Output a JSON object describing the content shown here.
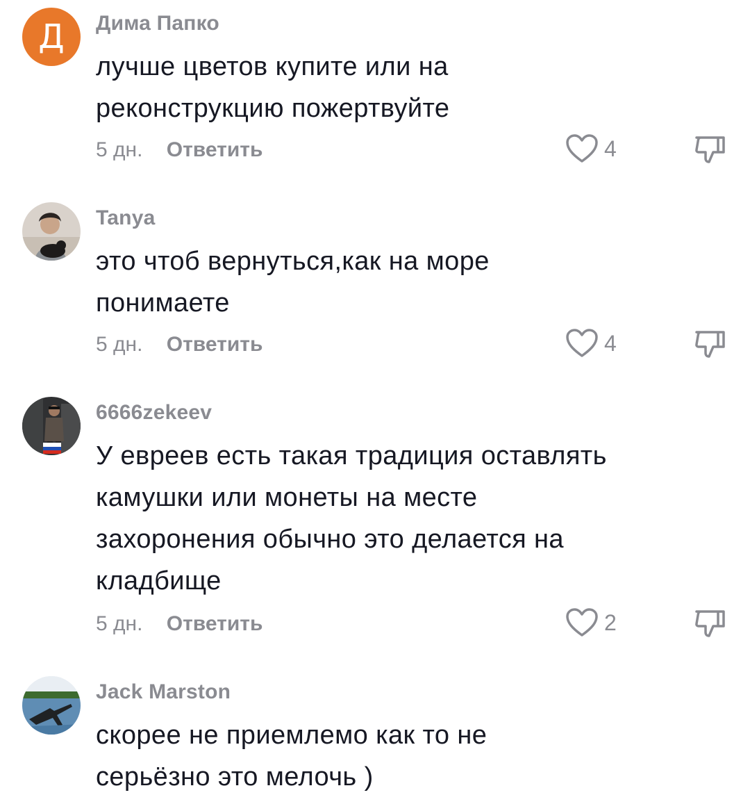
{
  "comments": [
    {
      "avatar_letter": "Д",
      "username": "Дима Папко",
      "lines": [
        "лучше цветов купите или на",
        "реконструкцию пожертвуйте"
      ],
      "time": "5 дн.",
      "reply_label": "Ответить",
      "likes": "4"
    },
    {
      "username": "Tanya",
      "lines": [
        "это чтоб вернуться,как на море",
        "понимаете"
      ],
      "time": "5 дн.",
      "reply_label": "Ответить",
      "likes": "4"
    },
    {
      "username": "6666zekeev",
      "lines": [
        "У евреев есть такая традиция оставлять",
        "камушки или монеты на месте",
        "захоронения обычно это делается на",
        "кладбище"
      ],
      "time": "5 дн.",
      "reply_label": "Ответить",
      "likes": "2"
    },
    {
      "username": "Jack Marston",
      "lines": [
        "скорее не приемлемо как то не",
        "серьёзно это мелочь )"
      ]
    }
  ],
  "colors": {
    "avatar_letter_bg": "#e8782a",
    "muted_text": "#8a8b91",
    "primary_text": "#161823"
  },
  "icons": [
    "heart-outline-icon",
    "thumbs-down-icon"
  ]
}
